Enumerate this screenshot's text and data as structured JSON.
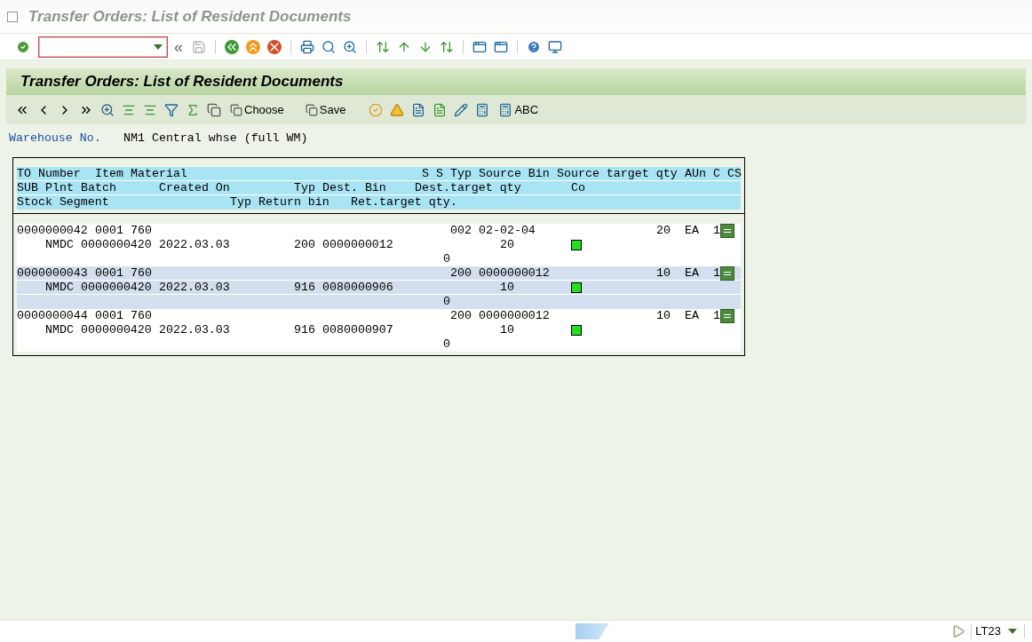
{
  "window": {
    "title": "Transfer Orders: List of Resident Documents"
  },
  "screen_title": "Transfer Orders: List of Resident Documents",
  "app_toolbar": {
    "choose": "Choose",
    "save": "Save",
    "abc": "ABC"
  },
  "warehouse": {
    "label": "Warehouse No.",
    "value": "NM1 Central whse (full WM)"
  },
  "toolbar": {
    "collapse": "«"
  },
  "header_lines": [
    [
      "TO Number",
      "Item",
      "Material",
      "S",
      "S",
      "Typ",
      "Source Bin",
      "Source target qty",
      "AUn",
      "C",
      "CS"
    ],
    [
      "SUB",
      "Plnt",
      "Batch",
      "Created On",
      "Typ",
      "Dest. Bin",
      "Dest.target qty",
      "Co"
    ],
    [
      "Stock Segment",
      "Typ",
      "Return bin",
      "Ret.target qty."
    ]
  ],
  "rows": [
    {
      "to_number": "0000000042",
      "item": "0001",
      "material": "760",
      "source_type": "002",
      "source_bin": "02-02-04",
      "source_qty": "20",
      "aun": "EA",
      "c": "1",
      "plant": "NMDC",
      "batch": "0000000420",
      "created_on": "2022.03.03",
      "dest_type": "200",
      "dest_bin": "0000000012",
      "dest_qty": "20",
      "return_qty": "0"
    },
    {
      "to_number": "0000000043",
      "item": "0001",
      "material": "760",
      "source_type": "200",
      "source_bin": "0000000012",
      "source_qty": "10",
      "aun": "EA",
      "c": "1",
      "plant": "NMDC",
      "batch": "0000000420",
      "created_on": "2022.03.03",
      "dest_type": "916",
      "dest_bin": "0080000906",
      "dest_qty": "10",
      "return_qty": "0"
    },
    {
      "to_number": "0000000044",
      "item": "0001",
      "material": "760",
      "source_type": "200",
      "source_bin": "0000000012",
      "source_qty": "10",
      "aun": "EA",
      "c": "1",
      "plant": "NMDC",
      "batch": "0000000420",
      "created_on": "2022.03.03",
      "dest_type": "916",
      "dest_bin": "0080000907",
      "dest_qty": "10",
      "return_qty": "0"
    }
  ],
  "status_bar": {
    "transaction": "LT23"
  }
}
